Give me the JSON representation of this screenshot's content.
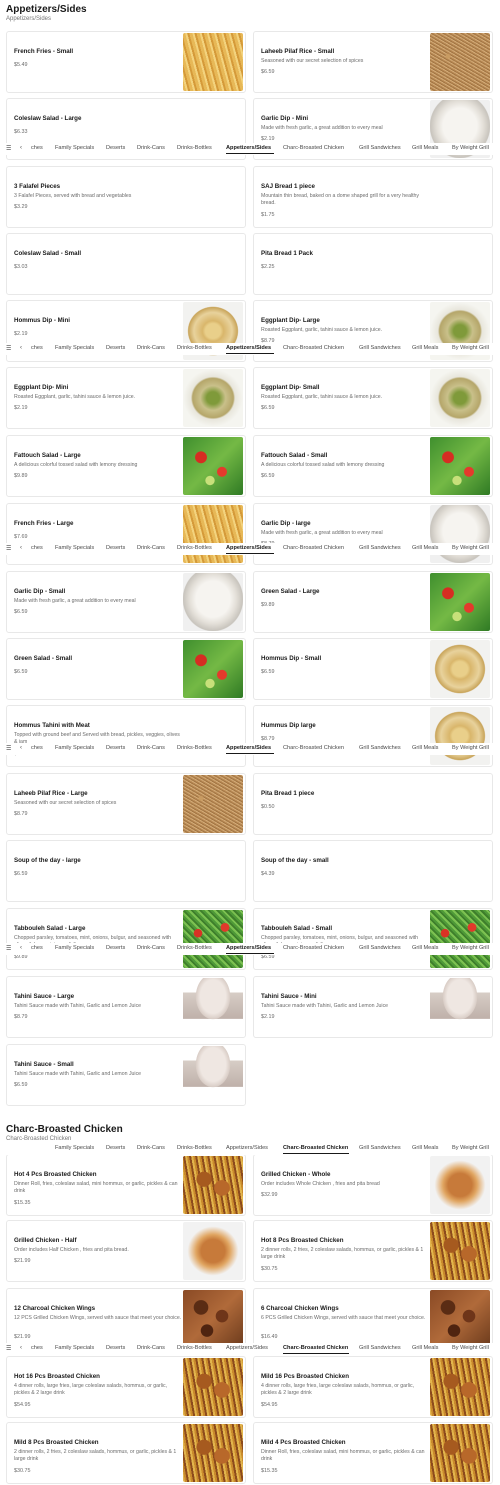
{
  "tabs": [
    "ches",
    "Family Specials",
    "Deserts",
    "Drink-Cans",
    "Drinks-Bottles",
    "Appetizers/Sides",
    "Charc-Broasted Chicken",
    "Grill Sandwiches",
    "Grill Meals",
    "By Weight Grill"
  ],
  "tabs_charc": [
    "Family Specials",
    "Deserts",
    "Drink-Cans",
    "Drinks-Bottles",
    "Appetizers/Sides",
    "Charc-Broasted Chicken",
    "Grill Sandwiches",
    "Grill Meals",
    "By Weight Grill"
  ],
  "appetizers": {
    "title": "Appetizers/Sides",
    "subtitle": "Appetizers/Sides",
    "items": [
      {
        "name": "French Fries - Small",
        "desc": "",
        "price": "$5.49",
        "img": "fries"
      },
      {
        "name": "Laheeb Pilaf Rice - Small",
        "desc": "Seasoned with our secret selection of spices",
        "price": "$6.59",
        "img": "rice"
      },
      {
        "name": "Coleslaw Salad - Large",
        "desc": "",
        "price": "$6.33",
        "img": ""
      },
      {
        "name": "Garlic Dip - Mini",
        "desc": "Made with fresh garlic, a great addition to every meal",
        "price": "$2.19",
        "img": "dip"
      },
      {
        "name": "3 Falafel Pieces",
        "desc": "3 Falafel Pieces, served with bread and vegetables",
        "price": "$3.29",
        "img": ""
      },
      {
        "name": "SAJ Bread 1 piece",
        "desc": "Mountain thin bread, baked on a dome shaped grill for a very healthy bread.",
        "price": "$1.75",
        "img": ""
      },
      {
        "name": "Coleslaw Salad - Small",
        "desc": "",
        "price": "$3.03",
        "img": ""
      },
      {
        "name": "Pita Bread 1 Pack",
        "desc": "",
        "price": "$2.25",
        "img": ""
      },
      {
        "name": "Hommus Dip - Mini",
        "desc": "",
        "price": "$2.19",
        "img": "hummus"
      },
      {
        "name": "Eggplant Dip- Large",
        "desc": "Roasted Eggplant, garlic, tahini sauce & lemon juice.",
        "price": "$8.79",
        "img": "baba"
      },
      {
        "name": "Eggplant Dip- Mini",
        "desc": "Roasted Eggplant, garlic, tahini sauce & lemon juice.",
        "price": "$2.19",
        "img": "baba"
      },
      {
        "name": "Eggplant Dip- Small",
        "desc": "Roasted Eggplant, garlic, tahini sauce & lemon juice.",
        "price": "$6.59",
        "img": "baba"
      },
      {
        "name": "Fattouch Salad - Large",
        "desc": "A delicious colorful tossed salad with lemony dressing",
        "price": "$9.89",
        "img": "salad"
      },
      {
        "name": "Fattouch Salad - Small",
        "desc": "A delicious colorful tossed salad with lemony dressing",
        "price": "$6.59",
        "img": "salad"
      },
      {
        "name": "French Fries - Large",
        "desc": "",
        "price": "$7.69",
        "img": "fries"
      },
      {
        "name": "Garlic Dip - large",
        "desc": "Made with fresh garlic, a great addition to every meal",
        "price": "$8.79",
        "img": "dip"
      },
      {
        "name": "Garlic Dip - Small",
        "desc": "Made with fresh garlic, a great addition to every meal",
        "price": "$6.59",
        "img": "dip"
      },
      {
        "name": "Green Salad - Large",
        "desc": "",
        "price": "$9.89",
        "img": "salad"
      },
      {
        "name": "Green Salad - Small",
        "desc": "",
        "price": "$6.59",
        "img": "salad"
      },
      {
        "name": "Hommus Dip - Small",
        "desc": "",
        "price": "$6.59",
        "img": "hummus"
      },
      {
        "name": "Hommus Tahini with Meat",
        "desc": "Topped with ground beef and Served with bread, pickles, veggies, olives & jam",
        "price": "$12.09",
        "img": ""
      },
      {
        "name": "Hummus Dip large",
        "desc": "",
        "price": "$8.79",
        "img": "hummus"
      },
      {
        "name": "Laheeb Pilaf Rice - Large",
        "desc": "Seasoned with our secret selection of spices",
        "price": "$8.79",
        "img": "rice"
      },
      {
        "name": "Pita Bread 1 piece",
        "desc": "",
        "price": "$0.50",
        "img": ""
      },
      {
        "name": "Soup of the day - large",
        "desc": "",
        "price": "$6.59",
        "img": ""
      },
      {
        "name": "Soup of the day - small",
        "desc": "",
        "price": "$4.39",
        "img": ""
      },
      {
        "name": "Tabbouleh Salad - Large",
        "desc": "Chopped parsley, tomatoes, mint, onions, bulgur, and seasoned with olive oil, lemon juice, salt & pepper",
        "price": "$9.89",
        "img": "tabouleh"
      },
      {
        "name": "Tabbouleh Salad - Small",
        "desc": "Chopped parsley, tomatoes, mint, onions, bulgur, and seasoned with olive oil, lemon juice, salt & pepper",
        "price": "$6.59",
        "img": "tabouleh"
      },
      {
        "name": "Tahini Sauce - Large",
        "desc": "Tahini Sauce made with Tahini, Garlic and Lemon Juice",
        "price": "$8.79",
        "img": "tahini"
      },
      {
        "name": "Tahini Sauce - Mini",
        "desc": "Tahini Sauce made with Tahini, Garlic and Lemon Juice",
        "price": "$2.19",
        "img": "tahini"
      },
      {
        "name": "Tahini Sauce - Small",
        "desc": "Tahini Sauce made with Tahini, Garlic and Lemon Juice",
        "price": "$6.59",
        "img": "tahini"
      }
    ]
  },
  "charc": {
    "title": "Charc-Broasted Chicken",
    "subtitle": "Charc-Broasted Chicken",
    "items": [
      {
        "name": "Hot 4 Pcs Broasted Chicken",
        "desc": "Dinner Roll, fries, coleslaw salad, mini hommus, or garlic, pickles & can drink",
        "price": "$15.35",
        "img": "chicken"
      },
      {
        "name": "Grilled Chicken - Whole",
        "desc": "Order includes Whole Chicken , fries and pita bread",
        "price": "$32.99",
        "img": "grilled"
      },
      {
        "name": "Grilled Chicken - Half",
        "desc": "Order includes Half Chicken , fries and pita bread.",
        "price": "$21.99",
        "img": "grilled"
      },
      {
        "name": "Hot 8 Pcs Broasted Chicken",
        "desc": "2 dinner rolls, 2 fries, 2 coleslaw salads, hommus, or garlic, pickles & 1 large drink",
        "price": "$30.75",
        "img": "chicken"
      },
      {
        "name": "12 Charcoal Chicken Wings",
        "desc": "12 PCS Grilled Chicken Wings, served with sauce that meet your choice.",
        "price": "$21.99",
        "img": "wings"
      },
      {
        "name": "6 Charcoal Chicken Wings",
        "desc": "6 PCS Grilled Chicken Wings, served with sauce that meet your choice.",
        "price": "$16.49",
        "img": "wings"
      },
      {
        "name": "Hot 16 Pcs Broasted Chicken",
        "desc": "4 dinner rolls, large fries, large coleslaw salads, hommus, or garlic, pickles & 2 large drink",
        "price": "$54.95",
        "img": "chicken"
      },
      {
        "name": "Mild 16 Pcs Broasted Chicken",
        "desc": "4 dinner rolls, large fries, large coleslaw salads, hommus, or garlic, pickles & 2 large drink",
        "price": "$54.95",
        "img": "chicken"
      },
      {
        "name": "Mild 8 Pcs Broasted Chicken",
        "desc": "2 dinner rolls, 2 fries, 2 coleslaw salads, hommus, or garlic, pickles & 1 large drink",
        "price": "$30.75",
        "img": "chicken"
      },
      {
        "name": "Mild 4 Pcs Broasted Chicken",
        "desc": "Dinner Roll, fries, coleslaw salad, mini hommus, or garlic, pickles & can drink",
        "price": "$15.35",
        "img": "chicken"
      }
    ]
  }
}
